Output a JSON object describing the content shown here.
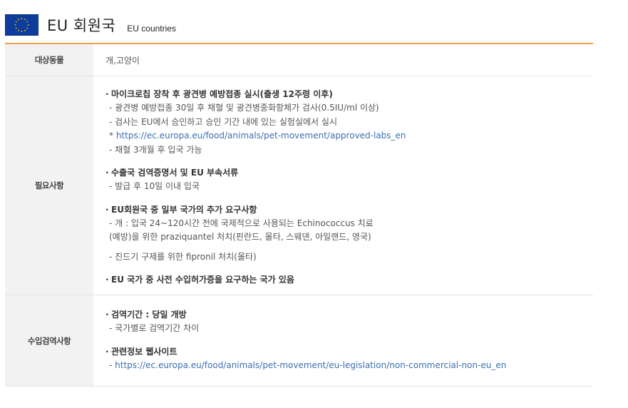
{
  "header": {
    "title": "EU 회원국",
    "subtitle": "EU countries",
    "flag_colors": {
      "background": "#0d3c9a",
      "stars": "#ffcc00"
    }
  },
  "accent_color": "#f0a04b",
  "rows": [
    {
      "label": "대상동물",
      "value": "개,고양이"
    },
    {
      "label": "필요사항",
      "sections": [
        {
          "heading": "마이크로칩 장착 후 광견병 예방접종 실시(출생 12주령 이후)",
          "lines": [
            "- 광견병 예방접종 30일 후 채혈 및 광견병중화항체가 검사(0.5IU/ml 이상)",
            "- 검사는 EU에서 승인하고 승인 기간 내에 있는 실험실에서 실시"
          ],
          "link_prefix": "* ",
          "link": "https://ec.europa.eu/food/animals/pet-movement/approved-labs_en",
          "after_link": "- 채혈 3개월 후 입국 가능"
        },
        {
          "heading": "수출국 검역증명서 및 EU 부속서류",
          "lines": [
            "- 발급 후 10일 이내 입국"
          ]
        },
        {
          "heading": "EU회원국 중 일부 국가의 추가 요구사항",
          "lines": [
            "- 개 : 입국 24~120시간 전에 국제적으로 사용되는 Echinococcus 치료",
            "(예방)을 위한 praziquantel 처치(핀란드, 몰타, 스웨덴, 아일랜드, 영국)"
          ],
          "extra_line": "- 진드기 구제를 위한 fipronil 처치(몰타)"
        },
        {
          "heading": "EU 국가 중 사전 수입허가증을 요구하는 국가 있음"
        }
      ]
    },
    {
      "label": "수입검역사항",
      "sections": [
        {
          "heading": "검역기간 : 당일 개방",
          "lines": [
            "- 국가별로 검역기간 차이"
          ]
        },
        {
          "heading": "관련정보 웹사이트",
          "link_prefix": "- ",
          "link": "https://ec.europa.eu/food/animals/pet-movement/eu-legislation/non-commercial-non-eu_en"
        }
      ]
    }
  ]
}
